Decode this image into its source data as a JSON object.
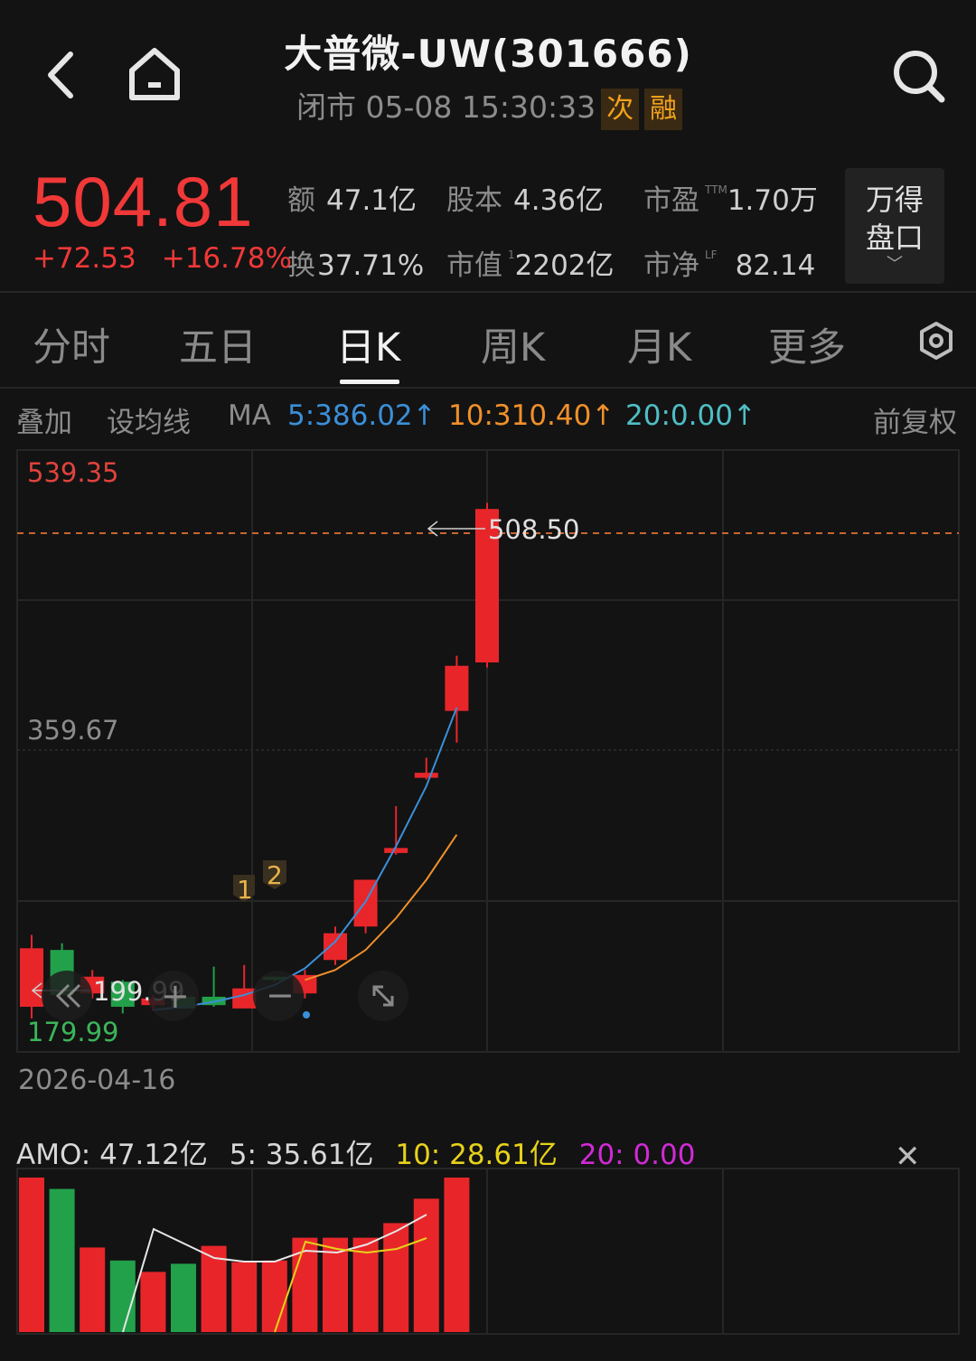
{
  "header": {
    "title": "大普微-UW(301666)",
    "status": "闭市 05-08 15:30:33",
    "tags": [
      "次",
      "融"
    ]
  },
  "quote": {
    "price": "504.81",
    "change": "+72.53",
    "change_pct": "+16.78%",
    "stats": [
      {
        "label": "额",
        "value": "47.1亿",
        "sup": ""
      },
      {
        "label": "股本",
        "value": "4.36亿",
        "sup": ""
      },
      {
        "label": "市盈",
        "value": "1.70万",
        "sup": "TTM"
      },
      {
        "label": "换",
        "value": "37.71%",
        "sup": ""
      },
      {
        "label": "市值",
        "value": "2202亿",
        "sup": "1"
      },
      {
        "label": "市净",
        "value": "82.14",
        "sup": "LF"
      }
    ],
    "wande_label_1": "万得",
    "wande_label_2": "盘口"
  },
  "tabs": [
    "分时",
    "五日",
    "日K",
    "周K",
    "月K",
    "更多"
  ],
  "active_tab": "日K",
  "ma_row": {
    "overlay": "叠加",
    "set_ma": "设均线",
    "ma": "MA",
    "ma5": "5:386.02↑",
    "ma10": "10:310.40↑",
    "ma20": "20:0.00↑",
    "adjust": "前复权",
    "colors": {
      "ma5": "#3b8fd8",
      "ma10": "#f0902a",
      "ma20": "#4fbfc5"
    }
  },
  "chart_data": {
    "type": "candlestick",
    "y_axis_labels": [
      "539.35",
      "359.67",
      "179.99"
    ],
    "ylim": [
      179.99,
      539.35
    ],
    "high_marker": "508.50",
    "low_marker": "199.99",
    "start_date": "2026-04-16",
    "candles": [
      {
        "o": 242,
        "h": 250,
        "l": 199.99,
        "c": 207,
        "up": true
      },
      {
        "o": 241,
        "h": 245,
        "l": 219,
        "c": 214,
        "up": false
      },
      {
        "o": 225,
        "h": 229,
        "l": 212,
        "c": 215,
        "up": true
      },
      {
        "o": 222,
        "h": 223,
        "l": 203,
        "c": 207,
        "up": false
      },
      {
        "o": 212,
        "h": 214,
        "l": 205,
        "c": 208,
        "up": true
      },
      {
        "o": 206,
        "h": 212,
        "l": 207,
        "c": 213,
        "up": false
      },
      {
        "o": 213,
        "h": 231,
        "l": 207,
        "c": 208,
        "up": false
      },
      {
        "o": 218,
        "h": 232,
        "l": 208,
        "c": 206,
        "up": true
      },
      {
        "o": 223,
        "h": 224,
        "l": 222,
        "c": 225,
        "up": false
      },
      {
        "o": 215,
        "h": 229,
        "l": 212,
        "c": 226,
        "up": true
      },
      {
        "o": 235,
        "h": 255,
        "l": 232,
        "c": 251,
        "up": true
      },
      {
        "o": 255,
        "h": 268,
        "l": 251,
        "c": 283,
        "up": true
      },
      {
        "o": 299,
        "h": 327,
        "l": 298,
        "c": 302,
        "up": true
      },
      {
        "o": 344,
        "h": 356,
        "l": 343,
        "c": 347,
        "up": true
      },
      {
        "o": 384,
        "h": 417,
        "l": 365,
        "c": 411,
        "up": true
      },
      {
        "o": 413,
        "h": 508.5,
        "l": 410,
        "c": 504.81,
        "up": true
      }
    ],
    "ma5_line": [
      205,
      207,
      210,
      214,
      220,
      230,
      246,
      270,
      303,
      339,
      386
    ],
    "ma10_line": [
      223,
      229,
      241,
      260,
      283,
      310
    ],
    "event_markers": [
      "1",
      "2"
    ]
  },
  "amo": {
    "label": "AMO: 47.12亿",
    "ma5": "5: 35.61亿",
    "ma10": "10: 28.61亿",
    "ma20": "20: 0.00",
    "values": [
      95,
      88,
      52,
      44,
      37,
      42,
      53,
      43,
      44,
      58,
      58,
      58,
      67,
      82,
      95
    ],
    "up": [
      true,
      false,
      true,
      false,
      true,
      false,
      true,
      true,
      true,
      true,
      true,
      true,
      true,
      true,
      true
    ]
  },
  "controls": {
    "zoom_in": "+",
    "zoom_out": "−"
  }
}
